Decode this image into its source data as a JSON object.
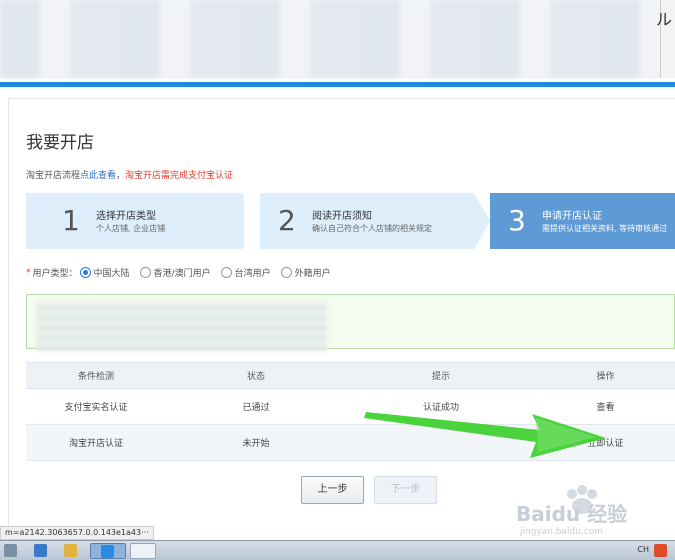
{
  "browser": {
    "right_glyph": "ル"
  },
  "page": {
    "title": "我要开店",
    "flow": {
      "prefix": "淘宝开店流程",
      "link": "点此查看",
      "sep": "，",
      "notice": "淘宝开店需完成支付宝认证"
    }
  },
  "steps": [
    {
      "num": "1",
      "title": "选择开店类型",
      "desc": "个人店铺, 企业店铺"
    },
    {
      "num": "2",
      "title": "阅读开店须知",
      "desc": "确认自己符合个人店铺的相关规定"
    },
    {
      "num": "3",
      "title": "申请开店认证",
      "desc": "需提供认证相关资料, 等待审核通过"
    }
  ],
  "user_type": {
    "label": "用户类型：",
    "required_mark": "*",
    "options": [
      "中国大陆",
      "香港/澳门用户",
      "台湾用户",
      "外籍用户"
    ],
    "selected": "中国大陆"
  },
  "table": {
    "headers": [
      "条件检测",
      "状态",
      "提示",
      "操作"
    ],
    "rows": [
      {
        "condition": "支付宝实名认证",
        "status": "已通过",
        "tip": "认证成功",
        "action": "查看"
      },
      {
        "condition": "淘宝开店认证",
        "status": "未开始",
        "tip": "",
        "action": "立即认证"
      }
    ]
  },
  "buttons": {
    "prev": "上一步",
    "next": "下一步"
  },
  "status_bar": {
    "url": "m=a2142.3063657.0.0.143e1a43···"
  },
  "taskbar": {
    "tray": "CH"
  },
  "watermark": {
    "brand": "Baidu 经验",
    "sub": "jingyan.baidu.com"
  },
  "colors": {
    "accent": "#1e8ae0",
    "step_active": "#5d9ad6",
    "step_inactive": "#dfeefb",
    "success": "#3cb034",
    "link": "#2d7ad6",
    "alert": "#e23a2a",
    "arrow": "#3ccf2b"
  }
}
